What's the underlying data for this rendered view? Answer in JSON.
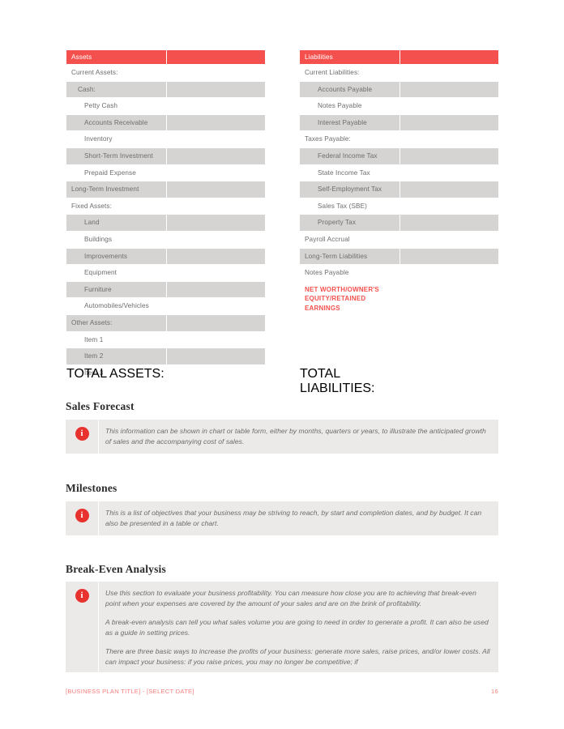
{
  "balance_sheet": {
    "assets": {
      "header": {
        "title": "Assets",
        "value": ""
      },
      "rows": [
        {
          "label": "Current Assets:",
          "indent": 1,
          "shade": false
        },
        {
          "label": "Cash:",
          "indent": 2,
          "shade": true
        },
        {
          "label": "Petty Cash",
          "indent": 3,
          "shade": false
        },
        {
          "label": "Accounts Receivable",
          "indent": 3,
          "shade": true
        },
        {
          "label": "Inventory",
          "indent": 3,
          "shade": false
        },
        {
          "label": "Short-Term Investment",
          "indent": 3,
          "shade": true
        },
        {
          "label": "Prepaid Expense",
          "indent": 3,
          "shade": false
        },
        {
          "label": "Long-Term Investment",
          "indent": 1,
          "shade": true
        },
        {
          "label": "Fixed Assets:",
          "indent": 1,
          "shade": false
        },
        {
          "label": "Land",
          "indent": 3,
          "shade": true
        },
        {
          "label": "Buildings",
          "indent": 3,
          "shade": false
        },
        {
          "label": "Improvements",
          "indent": 3,
          "shade": true
        },
        {
          "label": "Equipment",
          "indent": 3,
          "shade": false
        },
        {
          "label": "Furniture",
          "indent": 3,
          "shade": true
        },
        {
          "label": "Automobiles/Vehicles",
          "indent": 3,
          "shade": false
        },
        {
          "label": "Other Assets:",
          "indent": 1,
          "shade": true
        },
        {
          "label": "Item 1",
          "indent": 3,
          "shade": false
        },
        {
          "label": "Item 2",
          "indent": 3,
          "shade": true
        },
        {
          "label": "Item 3",
          "indent": 3,
          "shade": false
        }
      ],
      "total": {
        "label": "TOTAL ASSETS:",
        "value": ""
      }
    },
    "liabilities": {
      "header": {
        "title": "Liabilities",
        "value": ""
      },
      "rows": [
        {
          "label": "Current Liabilities:",
          "indent": 1,
          "shade": false
        },
        {
          "label": "Accounts Payable",
          "indent": 3,
          "shade": true
        },
        {
          "label": "Notes Payable",
          "indent": 3,
          "shade": false
        },
        {
          "label": "Interest Payable",
          "indent": 3,
          "shade": true
        },
        {
          "label": "Taxes Payable:",
          "indent": 1,
          "shade": false
        },
        {
          "label": "Federal Income Tax",
          "indent": 3,
          "shade": true
        },
        {
          "label": "State Income Tax",
          "indent": 3,
          "shade": false
        },
        {
          "label": "Self-Employment Tax",
          "indent": 3,
          "shade": true
        },
        {
          "label": "Sales Tax (SBE)",
          "indent": 3,
          "shade": false
        },
        {
          "label": "Property Tax",
          "indent": 3,
          "shade": true
        },
        {
          "label": "Payroll Accrual",
          "indent": 1,
          "shade": false
        },
        {
          "label": "Long-Term Liabilities",
          "indent": 1,
          "shade": true
        },
        {
          "label": "Notes Payable",
          "indent": 1,
          "shade": false
        }
      ],
      "net_worth": {
        "label": "NET WORTH/OWNER'S EQUITY/RETAINED EARNINGS",
        "value": ""
      },
      "total": {
        "label": "TOTAL LIABILITIES:",
        "value": ""
      }
    }
  },
  "sections": {
    "sales_forecast": {
      "heading": "Sales Forecast",
      "icon": "info-icon",
      "icon_glyph": "i",
      "paragraphs": [
        "This information can be shown in chart or table form, either by months, quarters or years, to illustrate the anticipated growth of sales and the accompanying cost of sales."
      ]
    },
    "milestones": {
      "heading": "Milestones",
      "icon": "info-icon",
      "icon_glyph": "i",
      "paragraphs": [
        "This is a list of objectives that your business may be striving to reach, by start and completion dates, and by budget. It can also be presented in a table or chart."
      ]
    },
    "break_even": {
      "heading": "Break-Even Analysis",
      "icon": "info-icon",
      "icon_glyph": "i",
      "paragraphs": [
        "Use this section to evaluate your business profitability. You can measure how close you are to achieving that break-even point when your expenses are covered by the amount of your sales and are on the brink of profitability.",
        "A break-even analysis can tell you what sales volume you are going to need in order to generate a profit. It can also be used as a guide in setting prices.",
        "There are three basic ways to increase the profits of your business: generate more sales, raise prices, and/or lower costs. All can impact your business: if you raise prices, you may no longer be competitive; if"
      ]
    }
  },
  "footer": {
    "left": "[BUSINESS PLAN TITLE] - [SELECT DATE]",
    "page_number": "16"
  },
  "colors": {
    "accent_red": "#f4514e",
    "icon_red": "#e8322e",
    "row_shade": "#d6d4d2",
    "info_bg": "#eceae9",
    "footer_red": "#f4827f"
  }
}
